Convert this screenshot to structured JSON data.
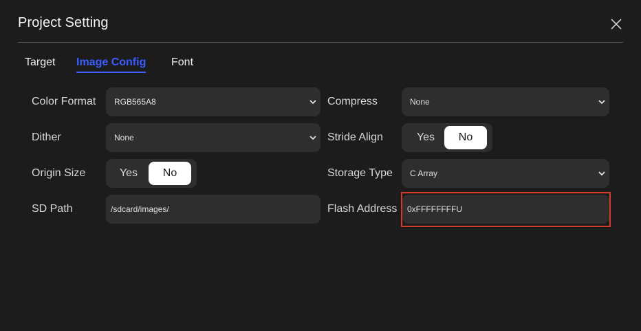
{
  "window": {
    "title": "Project Setting",
    "close_icon": "close-icon"
  },
  "tabs": [
    {
      "label": "Target",
      "active": false
    },
    {
      "label": "Image Config",
      "active": true
    },
    {
      "label": "Font",
      "active": false
    }
  ],
  "form": {
    "color_format": {
      "label": "Color Format",
      "value": "RGB565A8"
    },
    "compress": {
      "label": "Compress",
      "value": "None"
    },
    "dither": {
      "label": "Dither",
      "value": "None"
    },
    "stride_align": {
      "label": "Stride Align",
      "yes": "Yes",
      "no": "No",
      "selected": "No"
    },
    "origin_size": {
      "label": "Origin Size",
      "yes": "Yes",
      "no": "No",
      "selected": "No"
    },
    "storage_type": {
      "label": "Storage Type",
      "value": "C Array"
    },
    "sd_path": {
      "label": "SD Path",
      "value": "/sdcard/images/"
    },
    "flash_address": {
      "label": "Flash Address",
      "value": "0xFFFFFFFFU"
    }
  },
  "colors": {
    "background": "#1c1c1c",
    "field": "#2e2e2e",
    "accent": "#3b5cff",
    "highlight": "#d63a2a"
  }
}
